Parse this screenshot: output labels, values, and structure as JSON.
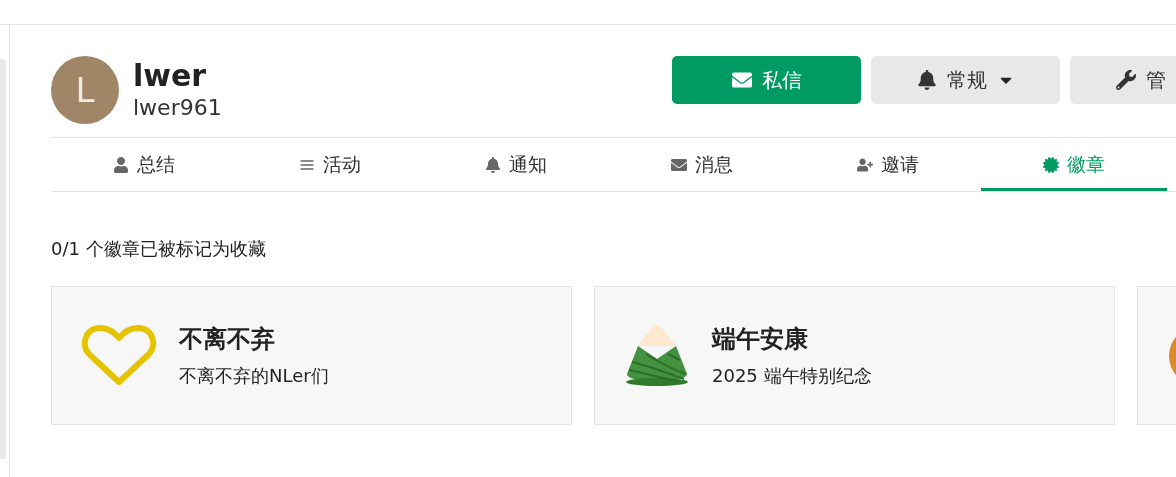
{
  "profile": {
    "avatar_letter": "L",
    "display_name": "lwer",
    "username": "lwer961"
  },
  "actions": [
    {
      "kind": "primary",
      "label": "私信"
    },
    {
      "kind": "dropdown",
      "label": "常规"
    },
    {
      "kind": "plain",
      "label": "管"
    }
  ],
  "tabs": [
    {
      "label": "总结",
      "selected": false
    },
    {
      "label": "活动",
      "selected": false
    },
    {
      "label": "通知",
      "selected": false
    },
    {
      "label": "消息",
      "selected": false
    },
    {
      "label": "邀请",
      "selected": false
    },
    {
      "label": "徽章",
      "selected": true
    }
  ],
  "summary": "0/1 个徽章已被标记为收藏",
  "badges": [
    {
      "title": "不离不弃",
      "description": "不离不弃的NLer们"
    },
    {
      "title": "端午安康",
      "description": "2025 端午特别纪念"
    }
  ]
}
